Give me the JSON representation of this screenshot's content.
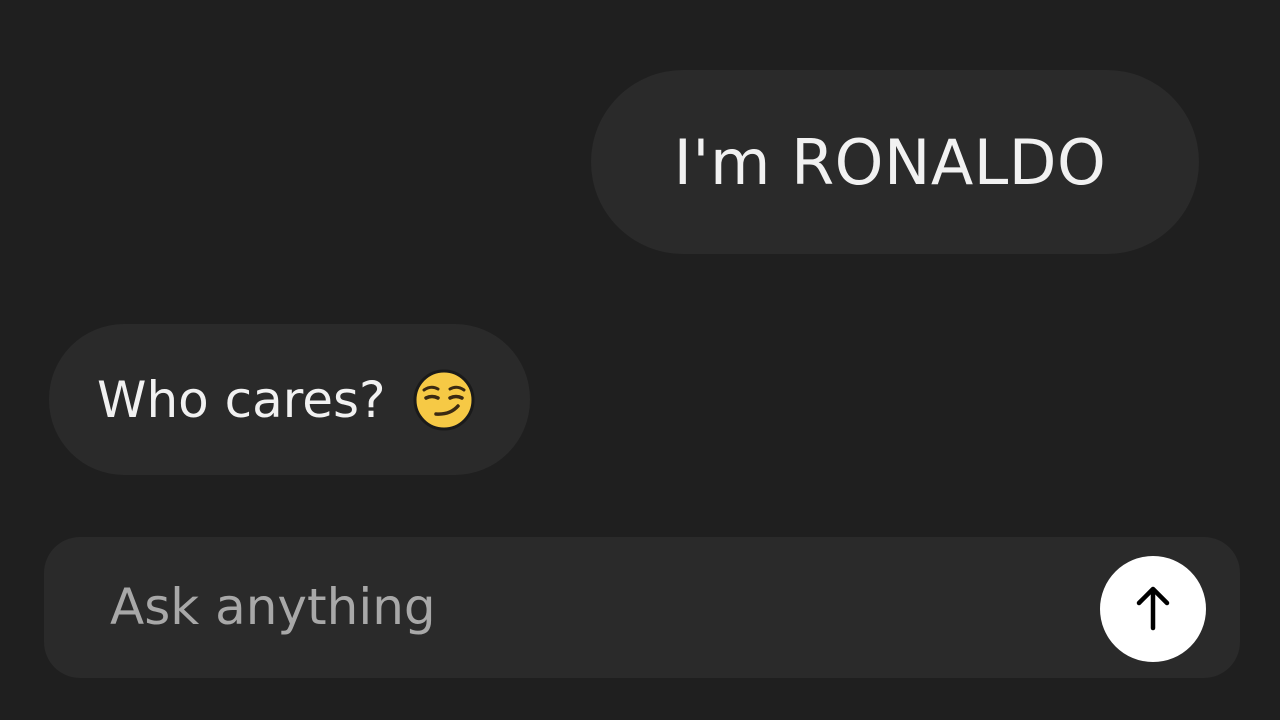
{
  "messages": {
    "user": {
      "text": "I'm RONALDO"
    },
    "assistant": {
      "text": "Who cares?",
      "emoji": "smirking-face-icon"
    }
  },
  "composer": {
    "placeholder": "Ask anything",
    "value": "",
    "send_icon": "arrow-up-icon"
  },
  "colors": {
    "background": "#1f1f1f",
    "bubble": "#2a2a2a",
    "text": "#f1f1f1",
    "placeholder": "#a8a8a8",
    "send_button": "#ffffff"
  }
}
